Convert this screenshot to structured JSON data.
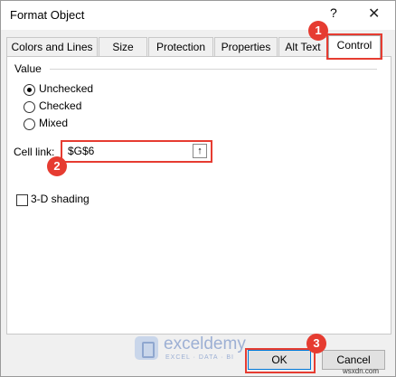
{
  "window": {
    "title": "Format Object",
    "help_icon": "?",
    "close_icon": "✕"
  },
  "tabs": [
    {
      "label": "Colors and Lines"
    },
    {
      "label": "Size"
    },
    {
      "label": "Protection"
    },
    {
      "label": "Properties"
    },
    {
      "label": "Alt Text"
    },
    {
      "label": "Control",
      "active": true
    }
  ],
  "value_group": {
    "label": "Value",
    "options": [
      {
        "label": "Unchecked",
        "selected": true
      },
      {
        "label": "Checked",
        "selected": false
      },
      {
        "label": "Mixed",
        "selected": false
      }
    ]
  },
  "cell_link": {
    "label": "Cell link:",
    "value": "$G$6",
    "button_icon": "↑"
  },
  "shading": {
    "label": "3-D shading",
    "checked": false
  },
  "badges": [
    "1",
    "2",
    "3"
  ],
  "watermark": {
    "name": "exceldemy",
    "tagline": "EXCEL · DATA · BI"
  },
  "buttons": {
    "ok": "OK",
    "cancel": "Cancel"
  },
  "site_label": "wsxdn.com",
  "colors": {
    "highlight": "#e63c31",
    "accent": "#0078d7"
  }
}
